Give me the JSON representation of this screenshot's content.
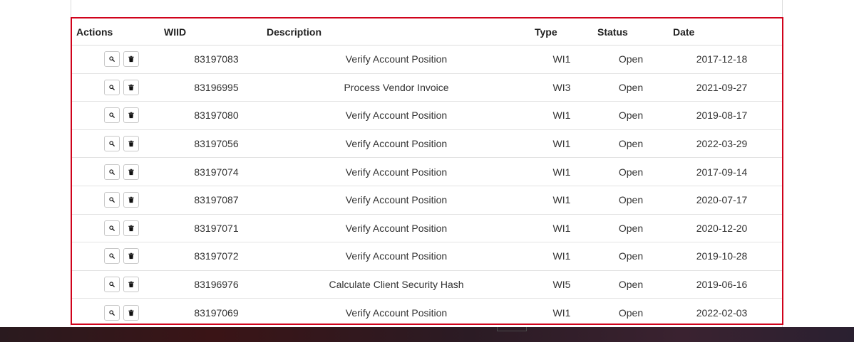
{
  "table": {
    "headers": {
      "actions": "Actions",
      "wiid": "WIID",
      "description": "Description",
      "type": "Type",
      "status": "Status",
      "date": "Date"
    },
    "rows": [
      {
        "wiid": "83197083",
        "description": "Verify Account Position",
        "type": "WI1",
        "status": "Open",
        "date": "2017-12-18"
      },
      {
        "wiid": "83196995",
        "description": "Process Vendor Invoice",
        "type": "WI3",
        "status": "Open",
        "date": "2021-09-27"
      },
      {
        "wiid": "83197080",
        "description": "Verify Account Position",
        "type": "WI1",
        "status": "Open",
        "date": "2019-08-17"
      },
      {
        "wiid": "83197056",
        "description": "Verify Account Position",
        "type": "WI1",
        "status": "Open",
        "date": "2022-03-29"
      },
      {
        "wiid": "83197074",
        "description": "Verify Account Position",
        "type": "WI1",
        "status": "Open",
        "date": "2017-09-14"
      },
      {
        "wiid": "83197087",
        "description": "Verify Account Position",
        "type": "WI1",
        "status": "Open",
        "date": "2020-07-17"
      },
      {
        "wiid": "83197071",
        "description": "Verify Account Position",
        "type": "WI1",
        "status": "Open",
        "date": "2020-12-20"
      },
      {
        "wiid": "83197072",
        "description": "Verify Account Position",
        "type": "WI1",
        "status": "Open",
        "date": "2019-10-28"
      },
      {
        "wiid": "83196976",
        "description": "Calculate Client Security Hash",
        "type": "WI5",
        "status": "Open",
        "date": "2019-06-16"
      },
      {
        "wiid": "83197069",
        "description": "Verify Account Position",
        "type": "WI1",
        "status": "Open",
        "date": "2022-02-03"
      }
    ],
    "row_action_icons": [
      "search-icon",
      "trash-icon"
    ]
  },
  "colors": {
    "highlight_border": "#d0021b",
    "row_divider": "#e3e3e3",
    "text": "#333333"
  }
}
